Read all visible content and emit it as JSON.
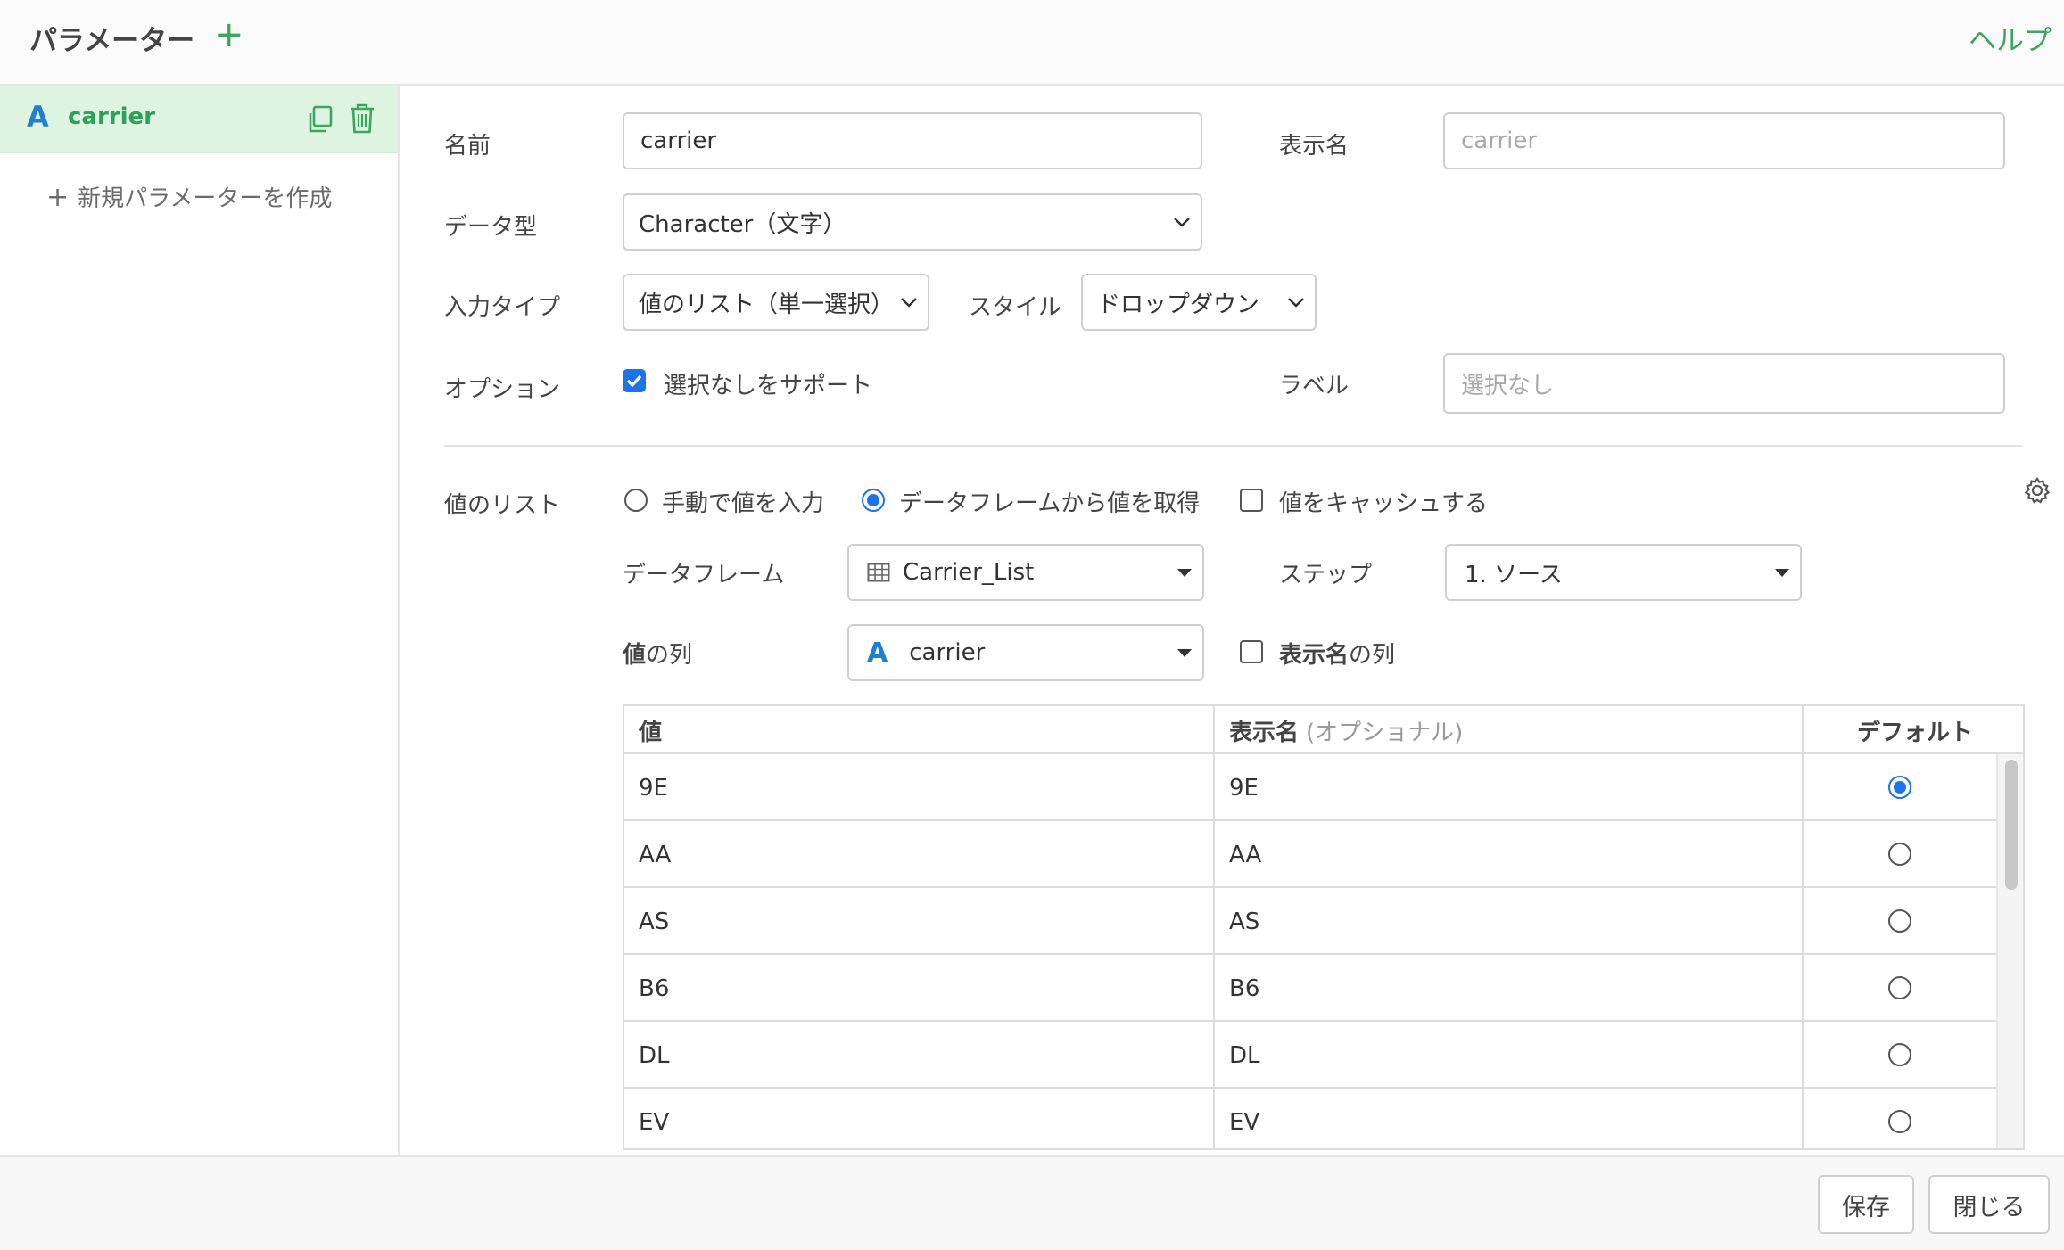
{
  "header": {
    "title": "パラメーター",
    "add_label": "+",
    "help_label": "ヘルプ"
  },
  "sidebar": {
    "items": [
      {
        "type_icon": "A",
        "name": "carrier"
      }
    ],
    "new_param_label": "新規パラメーターを作成"
  },
  "form": {
    "name_label": "名前",
    "name_value": "carrier",
    "display_name_label": "表示名",
    "display_name_placeholder": "carrier",
    "data_type_label": "データ型",
    "data_type_value": "Character（文字）",
    "input_type_label": "入力タイプ",
    "input_type_value": "値のリスト（単一選択）",
    "style_label": "スタイル",
    "style_value": "ドロップダウン",
    "option_label": "オプション",
    "option_checkbox_label": "選択なしをサポート",
    "option_checked": true,
    "label_label": "ラベル",
    "label_placeholder": "選択なし"
  },
  "value_list": {
    "section_label": "値のリスト",
    "radio_manual": "手動で値を入力",
    "radio_dataframe": "データフレームから値を取得",
    "selected_source": "dataframe",
    "cache_label": "値をキャッシュする",
    "cache_checked": false,
    "dataframe_label": "データフレーム",
    "dataframe_value": "Carrier_List",
    "step_label": "ステップ",
    "step_value": "1. ソース",
    "value_column_label_bold": "値",
    "value_column_label_rest": "の列",
    "value_column_type_icon": "A",
    "value_column_value": "carrier",
    "display_column_label_bold": "表示名",
    "display_column_label_rest": "の列",
    "display_column_checked": false
  },
  "table": {
    "headers": {
      "value": "値",
      "display": "表示名",
      "display_optional": "(オプショナル)",
      "default": "デフォルト"
    },
    "rows": [
      {
        "value": "9E",
        "display": "9E",
        "default": true
      },
      {
        "value": "AA",
        "display": "AA",
        "default": false
      },
      {
        "value": "AS",
        "display": "AS",
        "default": false
      },
      {
        "value": "B6",
        "display": "B6",
        "default": false
      },
      {
        "value": "DL",
        "display": "DL",
        "default": false
      },
      {
        "value": "EV",
        "display": "EV",
        "default": false
      }
    ]
  },
  "footer": {
    "save_label": "保存",
    "close_label": "閉じる"
  },
  "colors": {
    "accent_green": "#2ca15a",
    "selected_item_bg": "#dff3e1",
    "checkbox_blue": "#1d74e8",
    "type_icon_blue": "#1f7fd3"
  },
  "icons": [
    "plus-icon",
    "character-type-icon",
    "copy-icon",
    "trash-icon",
    "chevron-down-icon",
    "caret-down-icon",
    "table-icon",
    "gear-icon"
  ]
}
